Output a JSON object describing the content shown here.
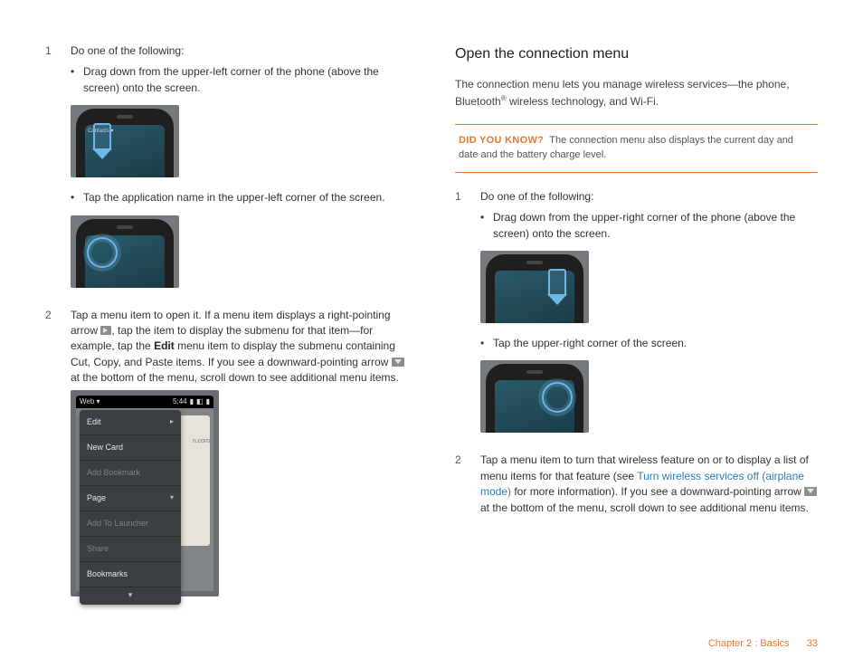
{
  "left": {
    "step1_num": "1",
    "step1": "Do one of the following:",
    "b1": "Drag down from the upper-left corner of the phone (above the screen) onto the screen.",
    "b2": "Tap the application name in the upper-left corner of the screen.",
    "appname": "Contacts ▾",
    "step2_num": "2",
    "step2a": "Tap a menu item to open it. If a menu item displays a right-pointing arrow ",
    "step2b": ", tap the item to display the submenu for that item—for example, tap the ",
    "step2_bold": "Edit",
    "step2c": " menu item to display the submenu containing Cut, Copy, and Paste items. If you see a downward-pointing arrow ",
    "step2d": " at the bottom of the menu, scroll down to see additional menu items.",
    "menu": {
      "status_left": "Web ▾",
      "status_time": "5:44",
      "edge_hint": "n.com",
      "edit": "Edit",
      "newcard": "New Card",
      "addbm": "Add Bookmark",
      "page": "Page",
      "addlaunch": "Add To Launcher",
      "share": "Share",
      "bookmarks": "Bookmarks"
    }
  },
  "right": {
    "heading": "Open the connection menu",
    "intro_a": "The connection menu lets you manage wireless services—the phone, Bluetooth",
    "intro_b": " wireless technology, and Wi-Fi.",
    "callout_lead": "DID YOU KNOW?",
    "callout": "The connection menu also displays the current day and date and the battery charge level.",
    "step1_num": "1",
    "step1": "Do one of the following:",
    "b1": "Drag down from the upper-right corner of the phone (above the screen) onto the screen.",
    "b2": "Tap the upper-right corner of the screen.",
    "step2_num": "2",
    "step2a": "Tap a menu item to turn that wireless feature on or to display a list of menu items for that feature (see ",
    "step2_link": "Turn wireless services off (airplane mode)",
    "step2b": " for more information). If you see a downward-pointing arrow ",
    "step2c": " at the bottom of the menu, scroll down to see additional menu items."
  },
  "footer": {
    "chapter": "Chapter 2 : Basics",
    "page": "33"
  }
}
